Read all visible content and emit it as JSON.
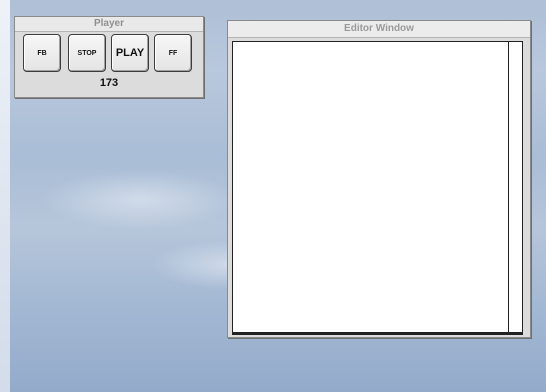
{
  "player": {
    "title": "Player",
    "buttons": {
      "rewind_label": "FB",
      "stop_label": "STOP",
      "play_label": "PLAY",
      "forward_label": "FF"
    },
    "counter": "173"
  },
  "editor": {
    "title": "Editor Window",
    "content_text": ""
  }
}
